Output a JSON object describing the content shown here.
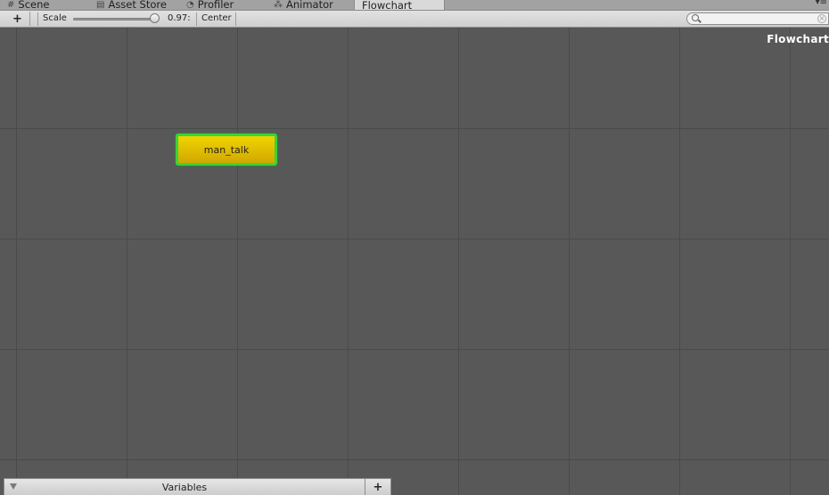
{
  "tabs": [
    {
      "label": "Scene",
      "icon": "grid-icon"
    },
    {
      "label": "Asset Store",
      "icon": "store-icon"
    },
    {
      "label": "Profiler",
      "icon": "profiler-icon"
    },
    {
      "label": "Animator",
      "icon": "animator-icon"
    },
    {
      "label": "Flowchart",
      "icon": "",
      "active": true
    }
  ],
  "toolbar": {
    "add_label": "+",
    "scale_label": "Scale",
    "scale_value": "0.97:",
    "scale_fraction": 0.97,
    "center_label": "Center",
    "search_placeholder": ""
  },
  "canvas": {
    "title": "Flowchart",
    "blocks": [
      {
        "name": "man_talk",
        "fill": "#e6c000",
        "outline": "#37d43a"
      }
    ]
  },
  "variables_panel": {
    "label": "Variables",
    "add_label": "+"
  }
}
